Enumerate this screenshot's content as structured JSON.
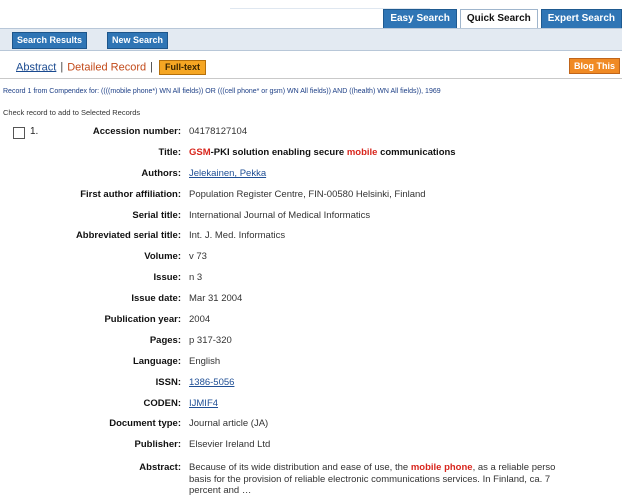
{
  "search_tabs": [
    "Easy Search",
    "Quick Search",
    "Expert Search"
  ],
  "nav": {
    "search_results": "Search Results",
    "new_search": "New Search"
  },
  "tabs": {
    "abstract": "Abstract",
    "sep": "|",
    "detailed": "Detailed Record",
    "full_text": "Full-text"
  },
  "blog_this": "Blog This",
  "record_line": "Record 1 from Compendex for: ((((mobile phone*) WN All fields)) OR (((cell phone* or gsm) WN All fields)) AND ((health) WN All fields)), 1969",
  "check_line": "Check record to add to Selected Records",
  "record_number": "1.",
  "fields": [
    {
      "label": "Accession number:",
      "value": "04178127104"
    },
    {
      "label": "Title:",
      "value_parts": [
        "GSM",
        "-PKI solution enabling secure ",
        "mobile",
        " communications"
      ]
    },
    {
      "label": "Authors:",
      "value": "Jelekainen, Pekka"
    },
    {
      "label": "First author affiliation:",
      "value": "Population Register Centre, FIN-00580 Helsinki, Finland"
    },
    {
      "label": "Serial title:",
      "value": "International Journal of Medical Informatics"
    },
    {
      "label": "Abbreviated serial title:",
      "value": "Int. J. Med. Informatics"
    },
    {
      "label": "Volume:",
      "value": "v 73"
    },
    {
      "label": "Issue:",
      "value": "n 3"
    },
    {
      "label": "Issue date:",
      "value": "Mar 31 2004"
    },
    {
      "label": "Publication year:",
      "value": "2004"
    },
    {
      "label": "Pages:",
      "value": "p 317-320"
    },
    {
      "label": "Language:",
      "value": "English"
    },
    {
      "label": "ISSN:",
      "value": "1386-5056"
    },
    {
      "label": "CODEN:",
      "value": "IJMIF4"
    },
    {
      "label": "Document type:",
      "value": "Journal article (JA)"
    },
    {
      "label": "Publisher:",
      "value": "Elsevier Ireland Ltd"
    }
  ],
  "abstract": {
    "label": "Abstract:",
    "parts": [
      "Because of its wide distribution and ease of use, the ",
      "mobile phone",
      ", as a reliable perso"
    ],
    "line2": "basis for the provision of reliable electronic communications services. In Finland, ca. 7",
    "line3": "percent and …"
  }
}
